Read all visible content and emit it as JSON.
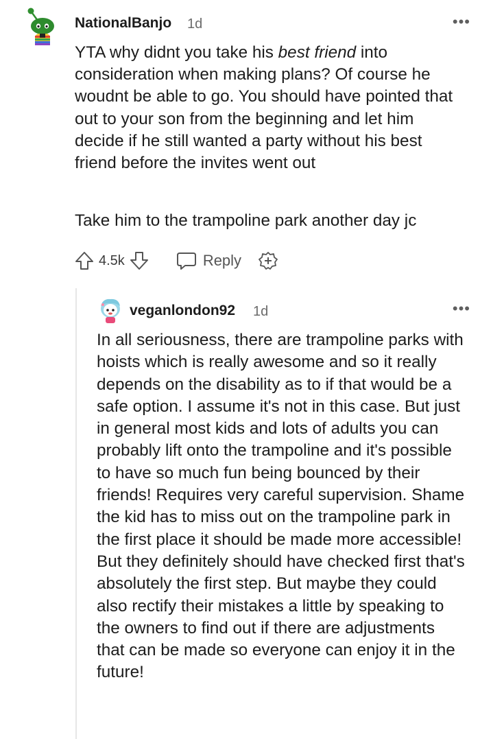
{
  "comment": {
    "username": "NationalBanjo",
    "age": "1d",
    "more_label": "•••",
    "avatar_icon": "snoo-avatar-icon",
    "paragraph1": {
      "before": "YTA why didnt you take his ",
      "emphasis": "best friend",
      "after": " into consideration when making plans? Of course he woudnt be able to go. You should have pointed that out to your son from the beginning and let him decide if he still wanted a party without his best friend before the invites went out"
    },
    "paragraph2": "Take him to the trampoline park another day jc",
    "actions": {
      "upvote_icon": "upvote-arrow-icon",
      "vote_count": "4.5k",
      "downvote_icon": "downvote-arrow-icon",
      "reply_icon": "speech-bubble-icon",
      "reply_label": "Reply",
      "award_icon": "award-plus-icon"
    }
  },
  "reply": {
    "username": "veganlondon92",
    "age": "1d",
    "more_label": "•••",
    "avatar_icon": "snoo-avatar-icon",
    "text": "In all seriousness, there are trampoline parks with hoists which is really awesome and so it really depends on the disability as to if that would be a safe option. I assume it's not in this case. But just in general most kids and lots of adults you can probably lift onto the trampoline and it's possible to have so much fun being bounced by their friends! Requires very careful supervision. Shame the kid has to miss out on the trampoline park in the first place it should be made more accessible! But they definitely should have checked first that's absolutely the first step. But maybe they could also rectify their mistakes a little by speaking to the owners to find out if there are adjustments that can be made so everyone can enjoy it in the future!"
  }
}
